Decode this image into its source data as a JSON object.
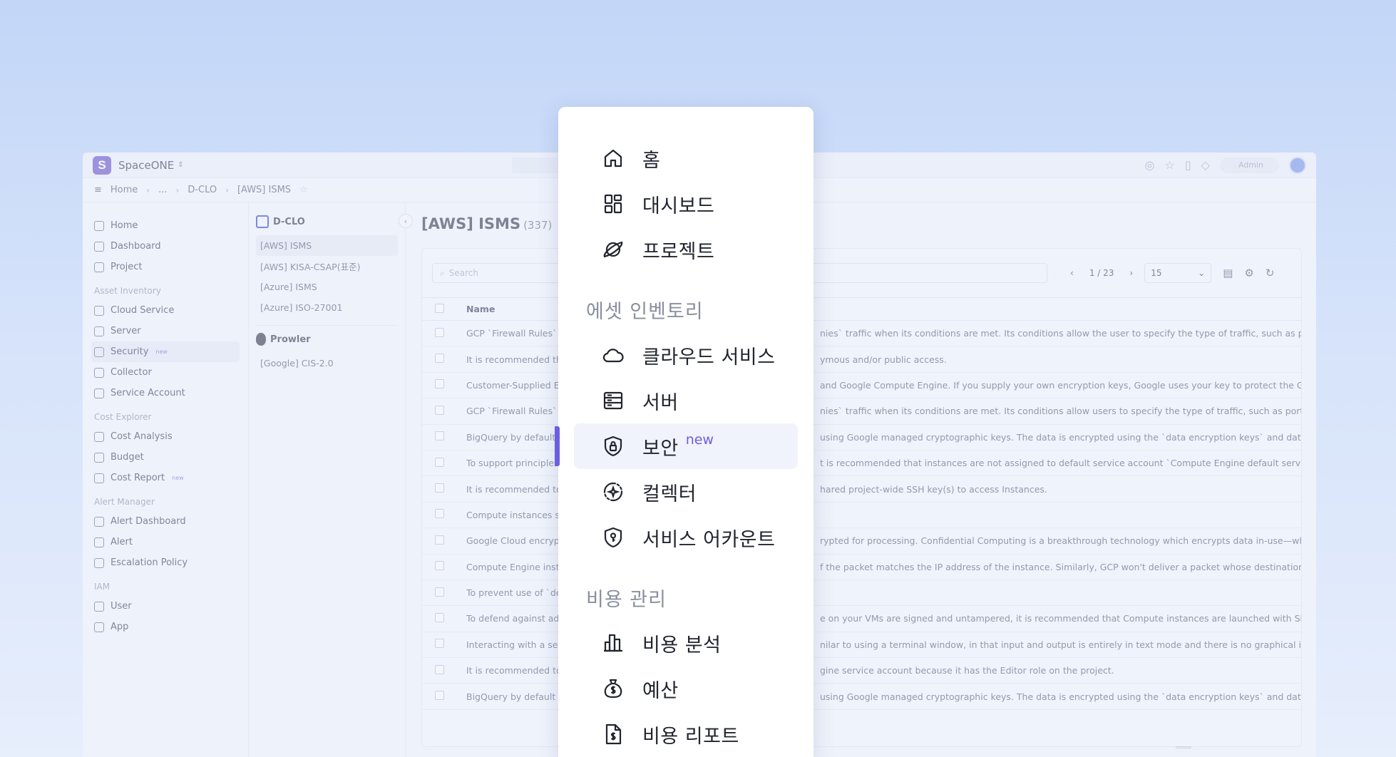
{
  "app": {
    "brand": "SpaceONE",
    "admin_label": "Admin",
    "logo_letter": "S"
  },
  "breadcrumb": {
    "home": "Home",
    "ellipsis": "...",
    "workspace": "D-CLO",
    "current": "[AWS] ISMS"
  },
  "lnb": {
    "top": [
      "Home",
      "Dashboard",
      "Project"
    ],
    "asset_head": "Asset Inventory",
    "asset": [
      "Cloud Service",
      "Server",
      "Security",
      "Collector",
      "Service Account"
    ],
    "cost_head": "Cost Explorer",
    "cost": [
      "Cost Analysis",
      "Budget",
      "Cost Report"
    ],
    "alert_head": "Alert Manager",
    "alert": [
      "Alert Dashboard",
      "Alert",
      "Escalation Policy"
    ],
    "iam_head": "IAM",
    "iam": [
      "User",
      "App"
    ],
    "new_tag": "new"
  },
  "tree": {
    "group1": "D-CLO",
    "group1_items": [
      "[AWS] ISMS",
      "[AWS] KISA-CSAP(표준)",
      "[Azure] ISMS",
      "[Azure] ISO-27001"
    ],
    "group2": "Prowler",
    "group2_items": [
      "[Google] CIS-2.0"
    ]
  },
  "main": {
    "title": "[AWS] ISMS",
    "count": "(337)",
    "search_placeholder": "Search",
    "page": "1 / 23",
    "page_size": "15",
    "name_header": "Name",
    "rows": [
      {
        "name": "GCP `Firewall Rules` a",
        "desc": "nies` traffic when its conditions are met. Its conditions allow the user to specify the type of traffic, such as ports and"
      },
      {
        "name": "It is recommended th",
        "desc": "ymous and/or public access."
      },
      {
        "name": "Customer-Supplied En",
        "desc": "and Google Compute Engine. If you supply your own encryption keys, Google uses your key to protect the Google-g"
      },
      {
        "name": "GCP `Firewall Rules` a",
        "desc": "nies` traffic when its conditions are met. Its conditions allow users to specify the type of traffic, such as ports and p"
      },
      {
        "name": "BigQuery by default e",
        "desc": "using Google managed cryptographic keys. The data is encrypted using the `data encryption keys` and data encryp"
      },
      {
        "name": "To support principle o",
        "desc": "t is recommended that instances are not assigned to default service account `Compute Engine default service accou"
      },
      {
        "name": "It is recommended to",
        "desc": "hared project-wide SSH key(s) to access Instances."
      },
      {
        "name": "Compute instances sh",
        "desc": ""
      },
      {
        "name": "Google Cloud encrypt",
        "desc": "rypted for processing. Confidential Computing is a breakthrough technology which encrypts data in-use—while it is"
      },
      {
        "name": "Compute Engine insta",
        "desc": "f the packet matches the IP address of the instance. Similarly, GCP won't deliver a packet whose destination IP addr"
      },
      {
        "name": "To prevent use of `def",
        "desc": ""
      },
      {
        "name": "To defend against adv",
        "desc": "e on your VMs are signed and untampered, it is recommended that Compute instances are launched with Shielded"
      },
      {
        "name": "Interacting with a ser",
        "desc": "nilar to using a terminal window, in that input and output is entirely in text mode and there is no graphical interface"
      },
      {
        "name": "It is recommended to",
        "desc": "gine service account because it has the Editor role on the project."
      },
      {
        "name": "BigQuery by default e",
        "desc": "using Google managed cryptographic keys. The data is encrypted using the `data encryption keys` and data encryp"
      }
    ]
  },
  "menu": {
    "home": "홈",
    "dashboard": "대시보드",
    "project": "프로젝트",
    "asset_head": "에셋 인벤토리",
    "cloud_service": "클라우드 서비스",
    "server": "서버",
    "security": "보안",
    "security_new": "new",
    "collector": "컬렉터",
    "service_account": "서비스 어카운트",
    "cost_head": "비용 관리",
    "cost_analysis": "비용 분석",
    "budget": "예산",
    "cost_report": "비용 리포트"
  },
  "colors": {
    "accent": "#6b5fe0",
    "background": "#c3d6f8"
  }
}
